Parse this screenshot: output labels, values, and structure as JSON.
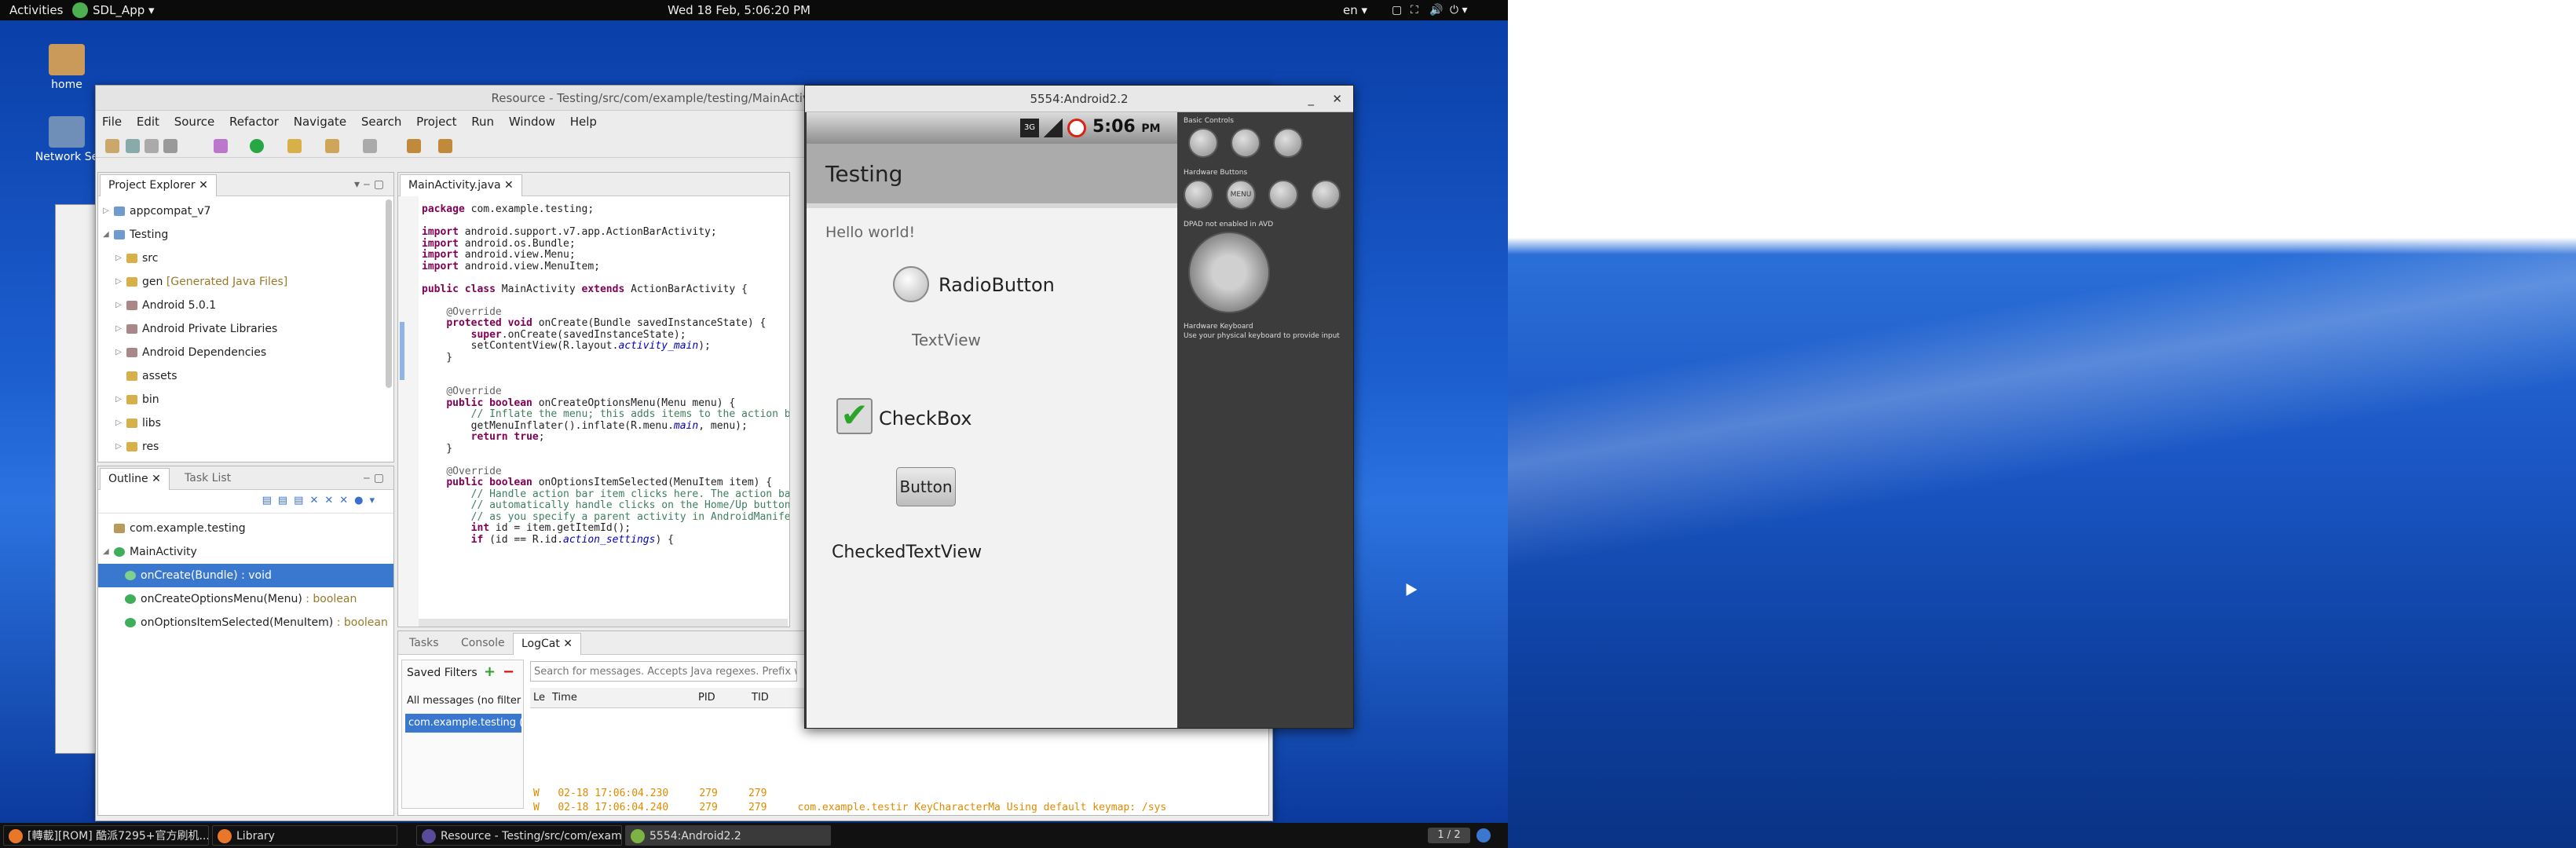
{
  "topbar": {
    "activities": "Activities",
    "app_menu": "SDL_App",
    "clock": "Wed 18 Feb,  5:06:20 PM",
    "lang": "en"
  },
  "desktop": {
    "icons": [
      {
        "label": "home"
      },
      {
        "label": "Network Se"
      }
    ]
  },
  "eclipse": {
    "title": "Resource - Testing/src/com/example/testing/MainActivity.java - Ec",
    "menu": [
      "File",
      "Edit",
      "Source",
      "Refactor",
      "Navigate",
      "Search",
      "Project",
      "Run",
      "Window",
      "Help"
    ],
    "project_explorer": {
      "tab": "Project Explorer",
      "items": [
        {
          "label": "appcompat_v7",
          "extra": ""
        },
        {
          "label": "Testing",
          "extra": ""
        },
        {
          "label": "src",
          "extra": ""
        },
        {
          "label": "gen",
          "extra": "[Generated Java Files]"
        },
        {
          "label": "Android 5.0.1",
          "extra": ""
        },
        {
          "label": "Android Private Libraries",
          "extra": ""
        },
        {
          "label": "Android Dependencies",
          "extra": ""
        },
        {
          "label": "assets",
          "extra": ""
        },
        {
          "label": "bin",
          "extra": ""
        },
        {
          "label": "libs",
          "extra": ""
        },
        {
          "label": "res",
          "extra": ""
        }
      ]
    },
    "outline": {
      "tab": "Outline",
      "tab2": "Task List",
      "items": [
        {
          "label": "com.example.testing",
          "type": ""
        },
        {
          "label": "MainActivity",
          "type": ""
        },
        {
          "label": "onCreate(Bundle) : void",
          "type": ""
        },
        {
          "label": "onCreateOptionsMenu(Menu)",
          "type": ": boolean"
        },
        {
          "label": "onOptionsItemSelected(MenuItem)",
          "type": ": boolean"
        }
      ]
    },
    "editor": {
      "tab": "MainActivity.java",
      "lines": [
        "package com.example.testing;",
        "",
        "import android.support.v7.app.ActionBarActivity;",
        "import android.os.Bundle;",
        "import android.view.Menu;",
        "import android.view.MenuItem;",
        "",
        "public class MainActivity extends ActionBarActivity {",
        "",
        "    @Override",
        "    protected void onCreate(Bundle savedInstanceState) {",
        "        super.onCreate(savedInstanceState);",
        "        setContentView(R.layout.activity_main);",
        "    }",
        "",
        "",
        "    @Override",
        "    public boolean onCreateOptionsMenu(Menu menu) {",
        "        // Inflate the menu; this adds items to the action bar",
        "        getMenuInflater().inflate(R.menu.main, menu);",
        "        return true;",
        "    }",
        "",
        "    @Override",
        "    public boolean onOptionsItemSelected(MenuItem item) {",
        "        // Handle action bar item clicks here. The action bar",
        "        // automatically handle clicks on the Home/Up button,",
        "        // as you specify a parent activity in AndroidManifest",
        "        int id = item.getItemId();",
        "        if (id == R.id.action_settings) {"
      ]
    },
    "bottom": {
      "tabs": [
        "Tasks",
        "Console",
        "LogCat"
      ],
      "saved_filters": "Saved Filters",
      "all_messages": "All messages (no filters",
      "selected_filter": "com.example.testing (",
      "search_placeholder": "Search for messages. Accepts Java regexes. Prefix w",
      "columns": [
        "Le",
        "Time",
        "PID",
        "TID"
      ],
      "log_rows": [
        {
          "level": "W",
          "time": "02-18 17:06:04.230",
          "pid": "279",
          "tid": "279",
          "msg": ""
        },
        {
          "level": "W",
          "time": "02-18 17:06:04.240",
          "pid": "279",
          "tid": "279",
          "msg": "com.example.testir KeyCharacterMa Using default keymap: /sys"
        }
      ]
    }
  },
  "emulator": {
    "title": "5554:Android2.2",
    "clock": "5:06",
    "ampm": "PM",
    "network": "3G",
    "app_title": "Testing",
    "hello": "Hello world!",
    "radio": "RadioButton",
    "textview": "TextView",
    "checkbox": "CheckBox",
    "button": "Button",
    "checked_textview": "CheckedTextView",
    "controls": {
      "basic": "Basic Controls",
      "hardware": "Hardware Buttons",
      "menu": "MENU",
      "dpad": "DPAD not enabled in AVD",
      "keyboard": "Hardware Keyboard",
      "keyboard_hint": "Use your physical keyboard to provide input"
    }
  },
  "taskbar": {
    "items": [
      {
        "label": "[轉載][ROM] 酷派7295+官方刷机...",
        "active": false
      },
      {
        "label": "Library",
        "active": false
      },
      {
        "label": "Resource - Testing/src/com/exam...",
        "active": false
      },
      {
        "label": "5554:Android2.2",
        "active": true
      }
    ],
    "pager": "1 / 2"
  }
}
